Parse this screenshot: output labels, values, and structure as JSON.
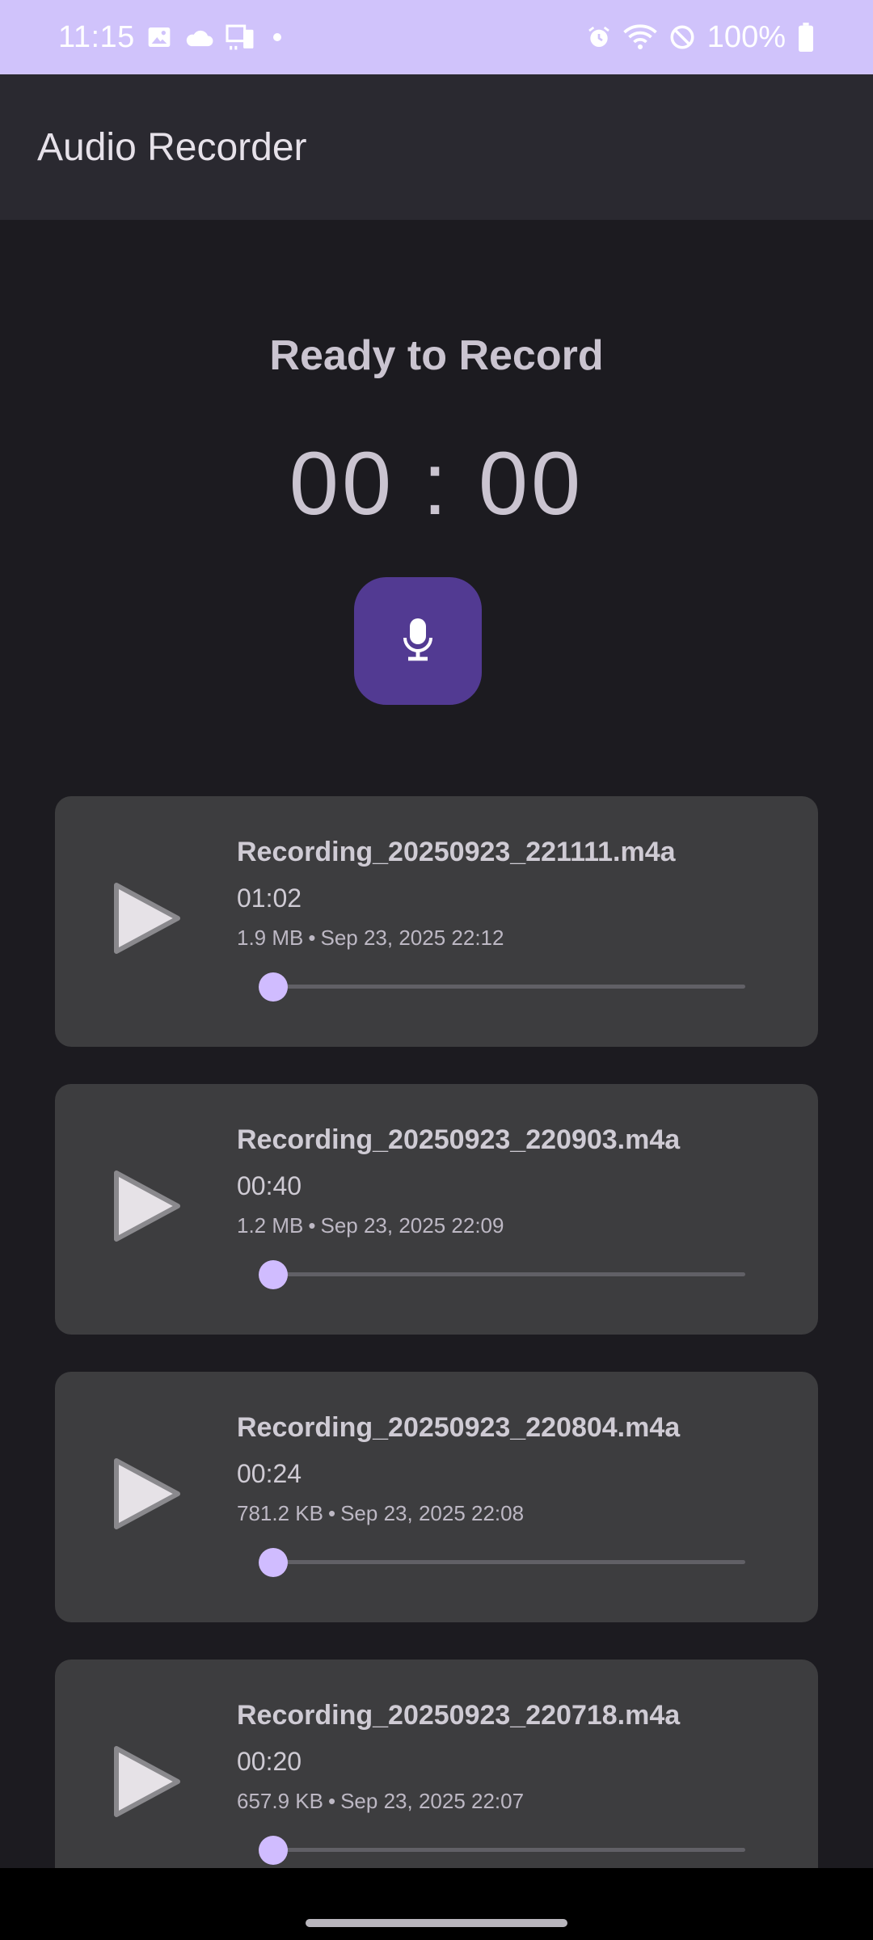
{
  "status_bar": {
    "time": "11:15",
    "battery": "100%",
    "background": "#d0c3fb",
    "left_icons": [
      "image-icon",
      "cloud-icon",
      "cast-icon",
      "dot-icon"
    ],
    "right_icons": [
      "alarm-icon",
      "wifi-icon",
      "do-not-disturb-icon",
      "battery-icon"
    ]
  },
  "app_bar": {
    "title": "Audio Recorder"
  },
  "recorder": {
    "status": "Ready to Record",
    "timer": "00 : 00",
    "record_icon": "microphone-icon",
    "button_color": "#523a92"
  },
  "recordings": [
    {
      "name": "Recording_20250923_221111.m4a",
      "duration": "01:02",
      "size": "1.9 MB",
      "separator": "•",
      "date": "Sep 23, 2025 22:12",
      "progress": 0
    },
    {
      "name": "Recording_20250923_220903.m4a",
      "duration": "00:40",
      "size": "1.2 MB",
      "separator": "•",
      "date": "Sep 23, 2025 22:09",
      "progress": 0
    },
    {
      "name": "Recording_20250923_220804.m4a",
      "duration": "00:24",
      "size": "781.2 KB",
      "separator": "•",
      "date": "Sep 23, 2025 22:08",
      "progress": 0
    },
    {
      "name": "Recording_20250923_220718.m4a",
      "duration": "00:20",
      "size": "657.9 KB",
      "separator": "•",
      "date": "Sep 23, 2025 22:07",
      "progress": 0
    }
  ],
  "colors": {
    "accent": "#d0bcff",
    "card": "#3d3d3f",
    "background": "#1c1b20"
  }
}
